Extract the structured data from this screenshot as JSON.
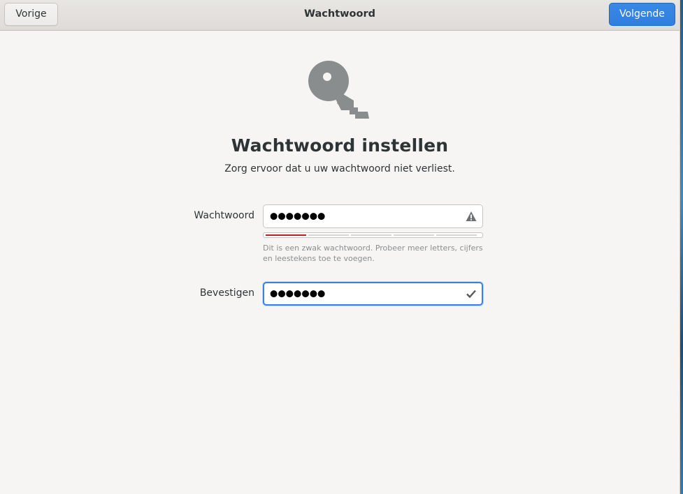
{
  "header": {
    "back_label": "Vorige",
    "title": "Wachtwoord",
    "next_label": "Volgende"
  },
  "main": {
    "icon": "key-icon",
    "title": "Wachtwoord instellen",
    "subtitle": "Zorg ervoor dat u uw wachtwoord niet verliest."
  },
  "password": {
    "label": "Wachtwoord",
    "masked_value": "●●●●●●●",
    "status_icon": "warning-icon",
    "strength_level": "1/5",
    "strength_color": "#c01c28",
    "hint": "Dit is een zwak wachtwoord. Probeer meer letters, cijfers en leestekens toe te voegen."
  },
  "confirm": {
    "label": "Bevestigen",
    "masked_value": "●●●●●●●",
    "status_icon": "checkmark-icon"
  },
  "colors": {
    "accent": "#3584e4",
    "weak": "#c01c28",
    "background": "#f6f5f4"
  }
}
